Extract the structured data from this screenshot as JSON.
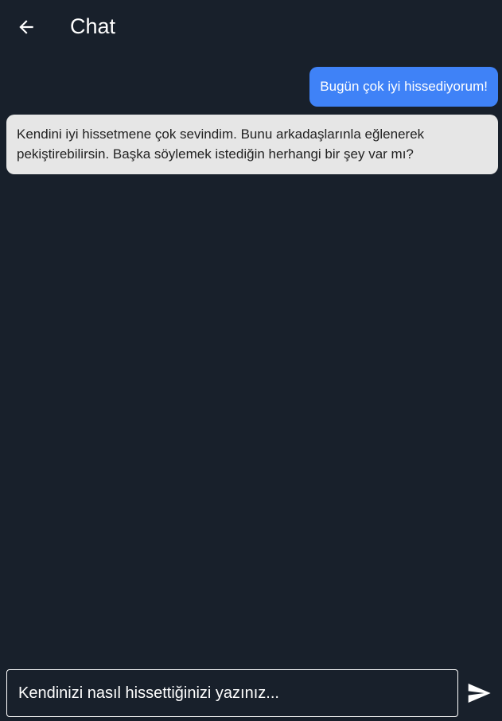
{
  "header": {
    "back_icon": "arrow-left-icon",
    "title": "Chat"
  },
  "messages": [
    {
      "role": "user",
      "text": "Bugün çok iyi hissediyorum!",
      "color": "#3f82f7"
    },
    {
      "role": "bot",
      "text": "Kendini iyi hissetmene çok sevindim. Bunu arkadaşlarınla eğlenerek pekiştirebilirsin. Başka söylemek istediğin herhangi bir şey var mı?",
      "color": "#e6e6e6"
    }
  ],
  "composer": {
    "placeholder": "Kendinizi nasıl hissettiğinizi yazınız...",
    "value": "",
    "send_icon": "send-icon"
  },
  "theme": {
    "background": "#18202b",
    "accent": "#3f82f7"
  }
}
